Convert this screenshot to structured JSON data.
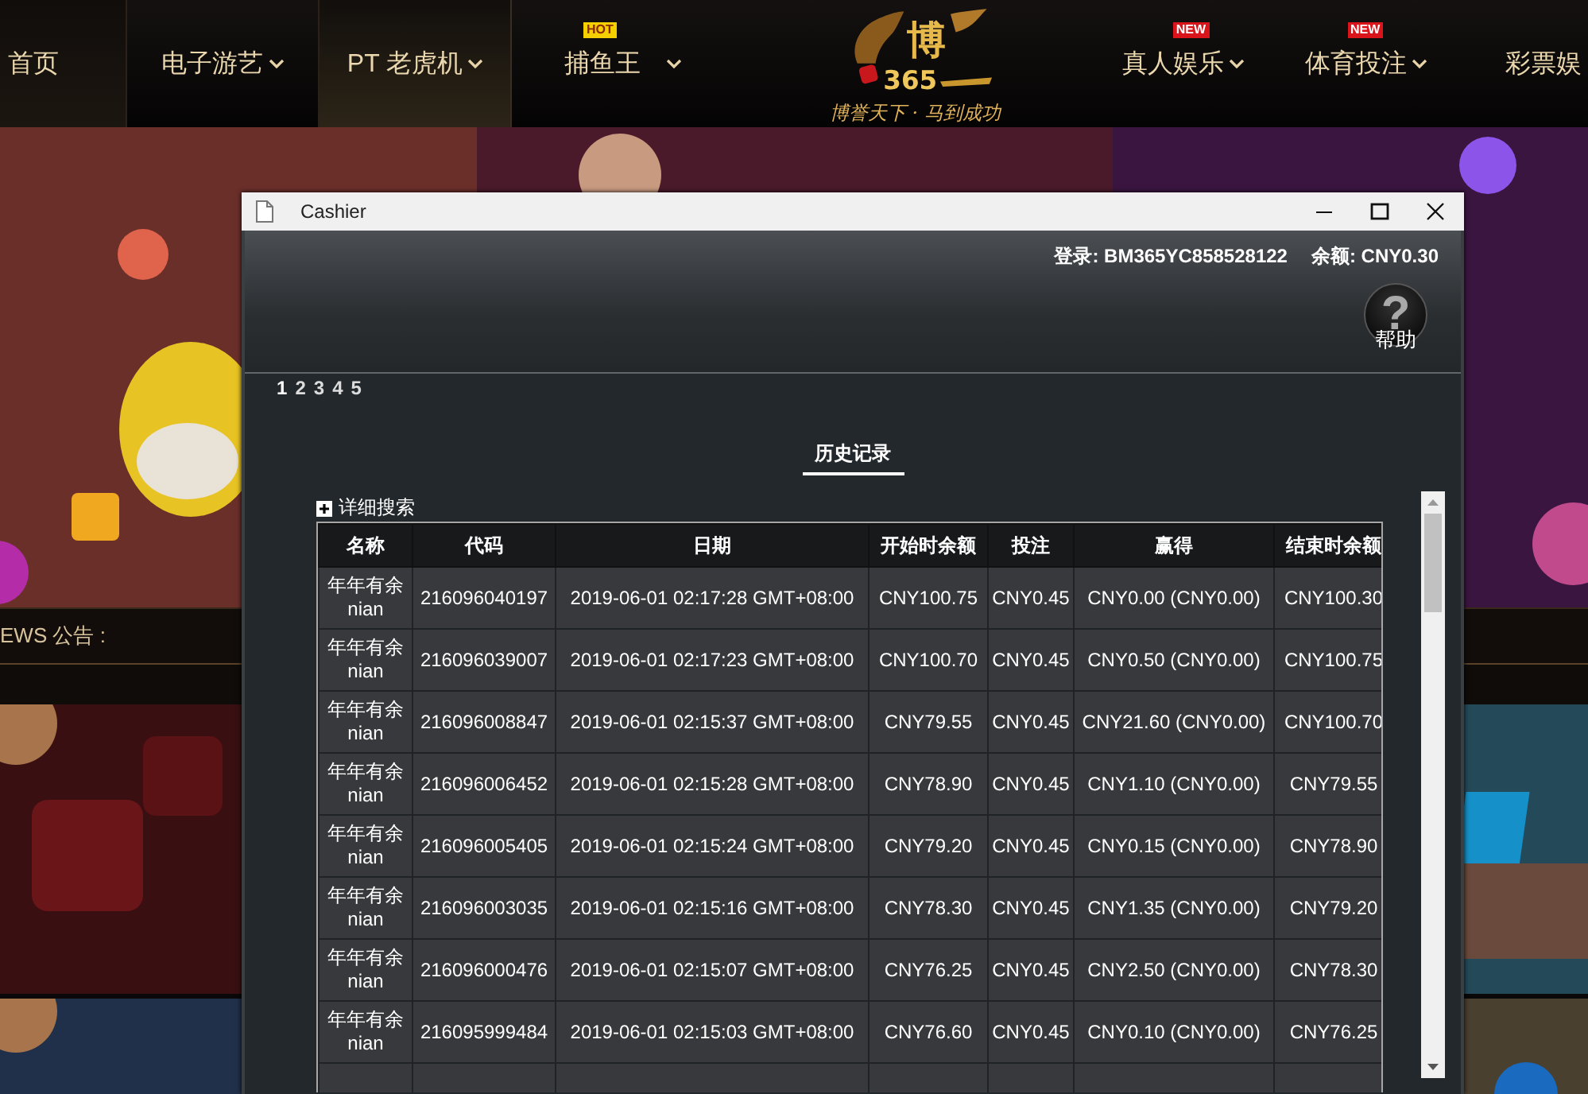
{
  "nav": {
    "items": [
      {
        "label": "首页",
        "dropdown": false
      },
      {
        "label": "电子游艺",
        "dropdown": true
      },
      {
        "label": "PT 老虎机",
        "dropdown": true
      },
      {
        "label": "捕鱼王",
        "dropdown": true,
        "badge": {
          "text": "HOT",
          "color": "#f5d000"
        }
      },
      {
        "label": "真人娱乐",
        "dropdown": true,
        "badge": {
          "text": "NEW",
          "color": "#d9141b"
        }
      },
      {
        "label": "体育投注",
        "dropdown": true,
        "badge": {
          "text": "NEW",
          "color": "#d9141b"
        }
      },
      {
        "label": "彩票娱",
        "dropdown": false
      }
    ],
    "logo": {
      "mark": "博",
      "number": "365",
      "slogan": "博誉天下 · 马到成功"
    }
  },
  "news": {
    "label": "EWS 公告 :"
  },
  "window": {
    "title": "Cashier",
    "account": "登录: BM365YC858528122",
    "balance": "余额: CNY0.30",
    "help": {
      "icon": "?",
      "label": "帮助"
    },
    "pages": [
      {
        "label": "1",
        "selected": true
      },
      {
        "label": "2",
        "selected": false
      },
      {
        "label": "3",
        "selected": false
      },
      {
        "label": "4",
        "selected": false
      },
      {
        "label": "5",
        "selected": false
      }
    ],
    "tabs": [
      {
        "label": "历史记录",
        "selected": true
      }
    ],
    "search_toggle": {
      "label": "详细搜索",
      "expanded": false
    },
    "table": {
      "columns": [
        "名称",
        "代码",
        "日期",
        "开始时余额",
        "投注",
        "赢得",
        "结束时余额"
      ],
      "rows": [
        [
          "年年有余\nnian",
          "216096040197",
          "2019-06-01 02:17:28 GMT+08:00",
          "CNY100.75",
          "CNY0.45",
          "CNY0.00 (CNY0.00)",
          "CNY100.30"
        ],
        [
          "年年有余\nnian",
          "216096039007",
          "2019-06-01 02:17:23 GMT+08:00",
          "CNY100.70",
          "CNY0.45",
          "CNY0.50 (CNY0.00)",
          "CNY100.75"
        ],
        [
          "年年有余\nnian",
          "216096008847",
          "2019-06-01 02:15:37 GMT+08:00",
          "CNY79.55",
          "CNY0.45",
          "CNY21.60 (CNY0.00)",
          "CNY100.70"
        ],
        [
          "年年有余\nnian",
          "216096006452",
          "2019-06-01 02:15:28 GMT+08:00",
          "CNY78.90",
          "CNY0.45",
          "CNY1.10 (CNY0.00)",
          "CNY79.55"
        ],
        [
          "年年有余\nnian",
          "216096005405",
          "2019-06-01 02:15:24 GMT+08:00",
          "CNY79.20",
          "CNY0.45",
          "CNY0.15 (CNY0.00)",
          "CNY78.90"
        ],
        [
          "年年有余\nnian",
          "216096003035",
          "2019-06-01 02:15:16 GMT+08:00",
          "CNY78.30",
          "CNY0.45",
          "CNY1.35 (CNY0.00)",
          "CNY79.20"
        ],
        [
          "年年有余\nnian",
          "216096000476",
          "2019-06-01 02:15:07 GMT+08:00",
          "CNY76.25",
          "CNY0.45",
          "CNY2.50 (CNY0.00)",
          "CNY78.30"
        ],
        [
          "年年有余\nnian",
          "216095999484",
          "2019-06-01 02:15:03 GMT+08:00",
          "CNY76.60",
          "CNY0.45",
          "CNY0.10 (CNY0.00)",
          "CNY76.25"
        ]
      ]
    }
  }
}
